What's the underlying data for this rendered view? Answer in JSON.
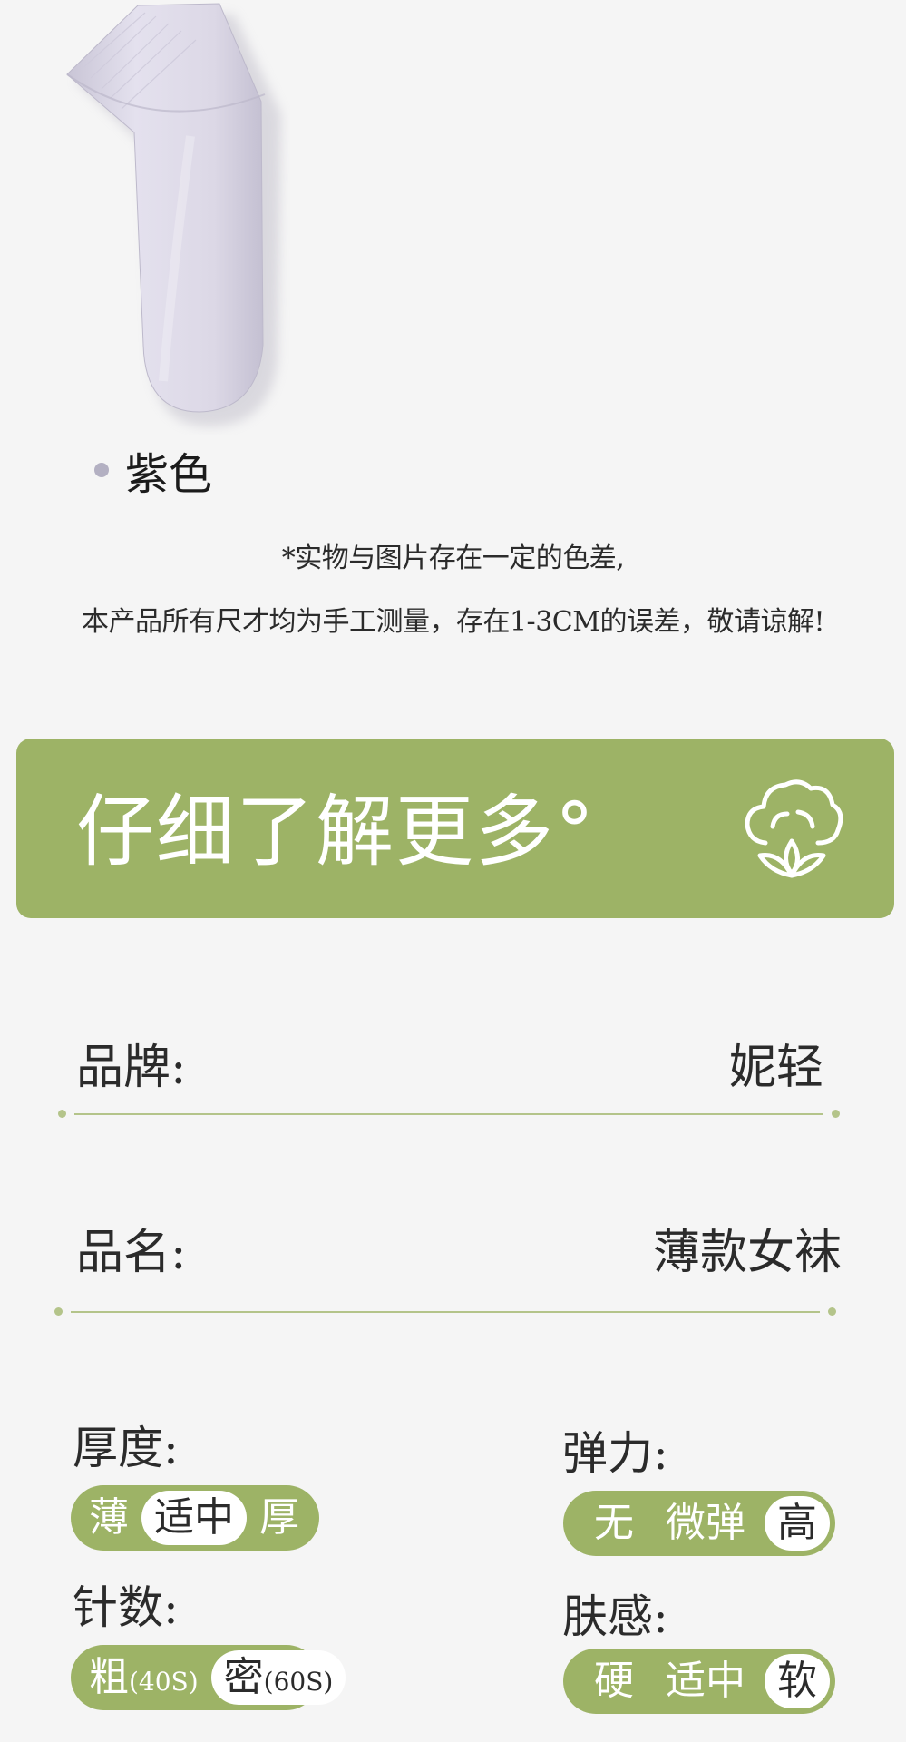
{
  "product": {
    "color_dot": "#b3b0c2",
    "color_label": "紫色",
    "sock_color": "#dcd9e6"
  },
  "notes": {
    "line1": "*实物与图片存在一定的色差,",
    "line2": "本产品所有尺才均为手工测量，存在1-3CM的误差，敬请谅解!"
  },
  "banner": {
    "title": "仔细了解更多°",
    "icon": "cotton-flower-icon",
    "background": "#9db366"
  },
  "specs": {
    "brand_label": "品牌:",
    "brand_value": "妮轻",
    "name_label": "品名:",
    "name_value": "薄款女袜",
    "divider_color": "#b4c48a"
  },
  "attributes": {
    "pill_color": "#9db366",
    "thickness": {
      "label": "厚度:",
      "options": [
        "薄",
        "适中",
        "厚"
      ],
      "selected": "适中"
    },
    "elasticity": {
      "label": "弹力:",
      "options": [
        "无",
        "微弹",
        "高"
      ],
      "selected": "高"
    },
    "needle_count": {
      "label": "针数:",
      "options": [
        {
          "main": "粗",
          "sub": "(40S)"
        },
        {
          "main": "密",
          "sub": "(60S)"
        }
      ],
      "selected": "密"
    },
    "skin_feel": {
      "label": "肤感:",
      "options": [
        "硬",
        "适中",
        "软"
      ],
      "selected": "软"
    }
  }
}
